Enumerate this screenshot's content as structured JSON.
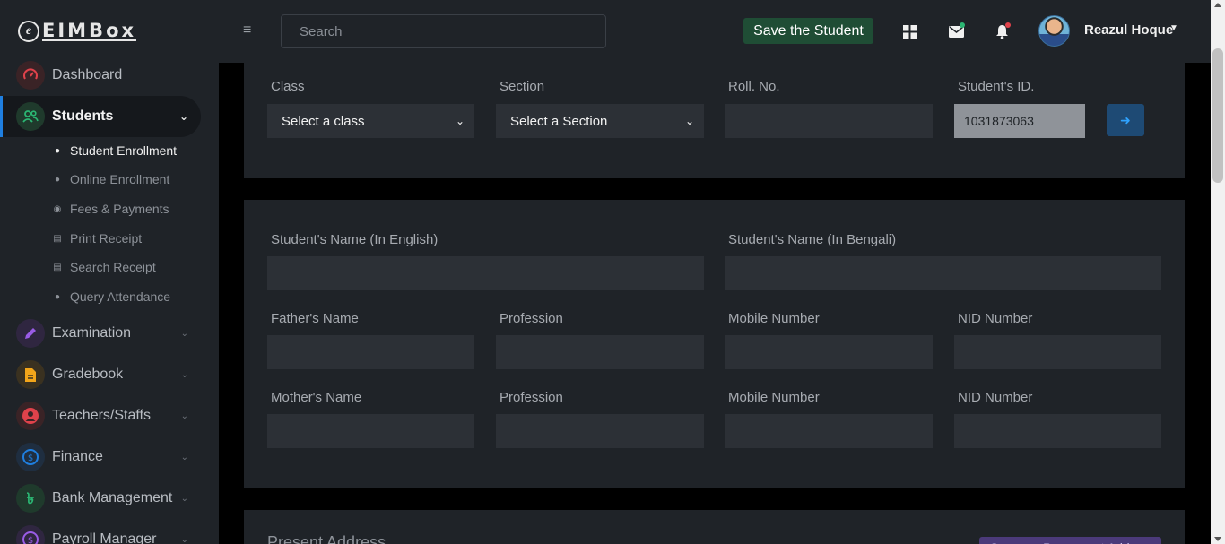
{
  "app": {
    "brand_text": "EIMBox",
    "brand_mark": "e"
  },
  "sidebar": {
    "items": [
      {
        "label": "Dashboard",
        "icon": "speedometer-icon",
        "color": "#e0424b",
        "active": false
      },
      {
        "label": "Students",
        "icon": "users-icon",
        "color": "#2bb673",
        "active": true
      },
      {
        "label": "Examination",
        "icon": "pencil-icon",
        "color": "#9a5ce6",
        "active": false
      },
      {
        "label": "Gradebook",
        "icon": "document-icon",
        "color": "#f2a51a",
        "active": false
      },
      {
        "label": "Teachers/Staffs",
        "icon": "user-circle-icon",
        "color": "#e0424b",
        "active": false
      },
      {
        "label": "Finance",
        "icon": "dollar-icon",
        "color": "#1f7fe0",
        "active": false
      },
      {
        "label": "Bank Management",
        "icon": "taka-icon",
        "color": "#2bb673",
        "active": false
      },
      {
        "label": "Payroll Manager",
        "icon": "dollar-icon",
        "color": "#9a5ce6",
        "active": false
      }
    ],
    "students_subitems": [
      {
        "label": "Student Enrollment",
        "icon": "person-icon",
        "active": true
      },
      {
        "label": "Online Enrollment",
        "icon": "person-plus-icon",
        "active": false
      },
      {
        "label": "Fees & Payments",
        "icon": "coin-icon",
        "active": false
      },
      {
        "label": "Print Receipt",
        "icon": "printer-icon",
        "active": false
      },
      {
        "label": "Search Receipt",
        "icon": "receipt-icon",
        "active": false
      },
      {
        "label": "Query Attendance",
        "icon": "group-icon",
        "active": false
      }
    ]
  },
  "topbar": {
    "search_placeholder": "Search",
    "save_label": "Save the Student",
    "user_name": "Reazul Hoque",
    "message_dot_color": "#2bb673",
    "notification_dot_color": "#e0424b"
  },
  "form": {
    "class_label": "Class",
    "class_value": "Select a class",
    "section_label": "Section",
    "section_value": "Select a Section",
    "roll_label": "Roll. No.",
    "roll_value": "",
    "student_id_label": "Student's ID.",
    "student_id_value": "1031873063",
    "name_en_label": "Student's Name (In English)",
    "name_en_value": "",
    "name_bn_label": "Student's Name (In Bengali)",
    "name_bn_value": "",
    "father_name_label": "Father's Name",
    "father_profession_label": "Profession",
    "father_mobile_label": "Mobile Number",
    "father_nid_label": "NID Number",
    "mother_name_label": "Mother's Name",
    "mother_profession_label": "Profession",
    "mother_mobile_label": "Mobile Number",
    "mother_nid_label": "NID Number",
    "present_address_label": "Present Address",
    "same_address_button": "Same as Permanent Address"
  }
}
